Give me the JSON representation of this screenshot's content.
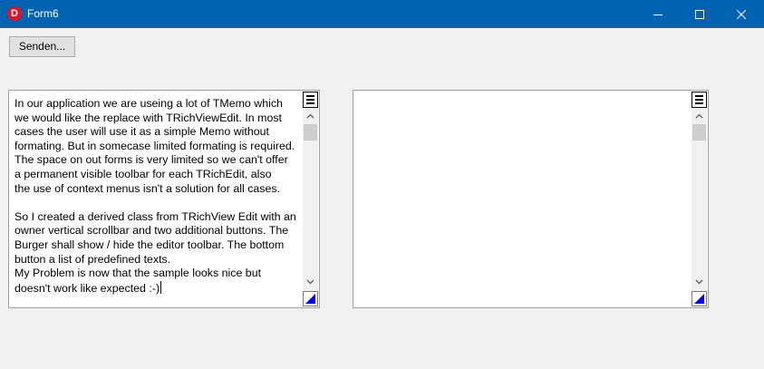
{
  "window": {
    "title": "Form6",
    "app_icon_letter": "D",
    "min_icon": "minimize-icon",
    "max_icon": "maximize-icon",
    "close_icon": "close-icon"
  },
  "toolbar": {
    "send_label": "Senden..."
  },
  "left_editor": {
    "lines": [
      "In our application we are useing a lot of TMemo which",
      "we would like the replace with TRichViewEdit. In most",
      "cases the user will use it as a simple Memo without",
      "formating. But in somecase limited formating is required.",
      "The space on out forms is very limited so we can't offer",
      "a permanent visible toolbar for each TRichEdit, also",
      "the use of context menus isn't a solution for all cases.",
      "",
      "So I created a derived class from TRichView Edit with an",
      "owner vertical scrollbar and two additional buttons. The",
      "Burger shall show / hide the editor toolbar. The bottom",
      "button a list of predefined texts.",
      "My Problem is now that the sample looks nice but",
      "doesn't work like expected :-)"
    ]
  },
  "right_editor": {
    "lines": []
  },
  "colors": {
    "titlebar": "#0063b1",
    "window_bg": "#f0f0f0",
    "predef_triangle": "#0000ff"
  }
}
